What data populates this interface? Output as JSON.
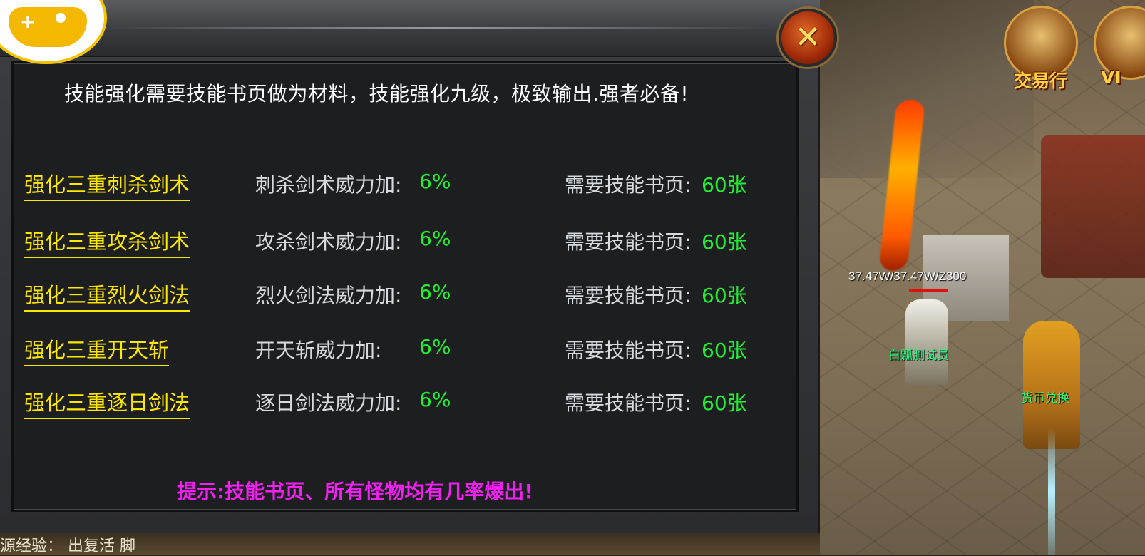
{
  "world": {
    "hud": {
      "trade_label": "交易行",
      "vip_label": "VI"
    },
    "player_hp": "37.47W/37.47W/Z300",
    "npcs": [
      {
        "name": "白瓢测试员"
      },
      {
        "name": "货币兑换"
      }
    ],
    "bottom_text": "源经验：    出复活         脚"
  },
  "dialog": {
    "intro": "技能强化需要技能书页做为材料，技能强化九级，极致输出.强者必备!",
    "rows": [
      {
        "skill": "强化三重刺杀剑术",
        "bonus_label": "刺杀剑术威力加:",
        "bonus_value": "6%",
        "cost_label": "需要技能书页:",
        "cost_value": "60张"
      },
      {
        "skill": "强化三重攻杀剑术",
        "bonus_label": "攻杀剑术威力加:",
        "bonus_value": "6%",
        "cost_label": "需要技能书页:",
        "cost_value": "60张"
      },
      {
        "skill": "强化三重烈火剑法",
        "bonus_label": "烈火剑法威力加:",
        "bonus_value": "6%",
        "cost_label": "需要技能书页:",
        "cost_value": "60张"
      },
      {
        "skill": "强化三重开天斩",
        "bonus_label": "开天斩威力加:",
        "bonus_value": "6%",
        "cost_label": "需要技能书页:",
        "cost_value": "60张"
      },
      {
        "skill": "强化三重逐日剑法",
        "bonus_label": "逐日剑法威力加:",
        "bonus_value": "6%",
        "cost_label": "需要技能书页:",
        "cost_value": "60张"
      }
    ],
    "tip": "提示:技能书页、所有怪物均有几率爆出!",
    "close_icon": "close-x-icon"
  },
  "colors": {
    "link": "#ffe800",
    "value": "#22ee33",
    "tip": "#f020f0",
    "label": "#d6dbe0"
  }
}
